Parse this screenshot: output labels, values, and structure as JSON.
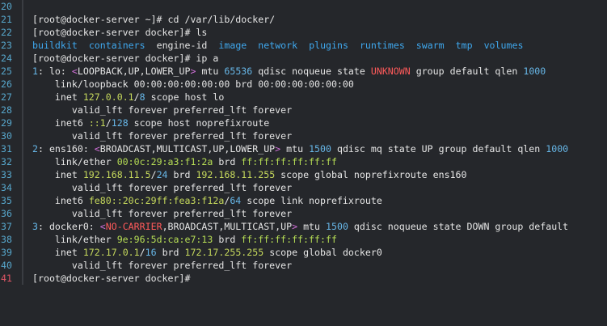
{
  "terminal": {
    "lines": [
      {
        "n": "20",
        "segs": [
          {
            "t": "",
            "c": "default"
          }
        ]
      },
      {
        "n": "21",
        "segs": [
          {
            "t": "[root@docker-server ~]# ",
            "c": "prompt"
          },
          {
            "t": "cd /var/lib/docker/",
            "c": "cmd"
          }
        ]
      },
      {
        "n": "22",
        "segs": [
          {
            "t": "[root@docker-server docker]# ",
            "c": "prompt"
          },
          {
            "t": "ls",
            "c": "cmd"
          }
        ]
      },
      {
        "n": "23",
        "segs": [
          {
            "t": "buildkit",
            "c": "ls-dir"
          },
          {
            "t": "  ",
            "c": "default"
          },
          {
            "t": "containers",
            "c": "ls-dir"
          },
          {
            "t": "  ",
            "c": "default"
          },
          {
            "t": "engine-id",
            "c": "ls-file"
          },
          {
            "t": "  ",
            "c": "default"
          },
          {
            "t": "image",
            "c": "ls-dir"
          },
          {
            "t": "  ",
            "c": "default"
          },
          {
            "t": "network",
            "c": "ls-dir"
          },
          {
            "t": "  ",
            "c": "default"
          },
          {
            "t": "plugins",
            "c": "ls-dir"
          },
          {
            "t": "  ",
            "c": "default"
          },
          {
            "t": "runtimes",
            "c": "ls-dir"
          },
          {
            "t": "  ",
            "c": "default"
          },
          {
            "t": "swarm",
            "c": "ls-dir"
          },
          {
            "t": "  ",
            "c": "default"
          },
          {
            "t": "tmp",
            "c": "ls-dir"
          },
          {
            "t": "  ",
            "c": "default"
          },
          {
            "t": "volumes",
            "c": "ls-dir"
          }
        ]
      },
      {
        "n": "24",
        "segs": [
          {
            "t": "[root@docker-server docker]# ",
            "c": "prompt"
          },
          {
            "t": "ip a",
            "c": "cmd"
          }
        ]
      },
      {
        "n": "25",
        "segs": [
          {
            "t": "1",
            "c": "num"
          },
          {
            "t": ": lo: ",
            "c": "default"
          },
          {
            "t": "<",
            "c": "sym"
          },
          {
            "t": "LOOPBACK,UP,LOWER_UP",
            "c": "default"
          },
          {
            "t": ">",
            "c": "sym"
          },
          {
            "t": " mtu ",
            "c": "default"
          },
          {
            "t": "65536",
            "c": "num"
          },
          {
            "t": " qdisc noqueue state ",
            "c": "default"
          },
          {
            "t": "UNKNOWN",
            "c": "bad"
          },
          {
            "t": " group default qlen ",
            "c": "default"
          },
          {
            "t": "1000",
            "c": "num"
          }
        ]
      },
      {
        "n": "26",
        "segs": [
          {
            "t": "    link/loopback 00:00:00:00:00:00 brd 00:00:00:00:00:00",
            "c": "default"
          }
        ]
      },
      {
        "n": "27",
        "segs": [
          {
            "t": "    inet ",
            "c": "default"
          },
          {
            "t": "127.0.0.1",
            "c": "addr"
          },
          {
            "t": "/",
            "c": "default"
          },
          {
            "t": "8",
            "c": "mask"
          },
          {
            "t": " scope host lo",
            "c": "default"
          }
        ]
      },
      {
        "n": "28",
        "segs": [
          {
            "t": "       valid_lft forever preferred_lft forever",
            "c": "default"
          }
        ]
      },
      {
        "n": "29",
        "segs": [
          {
            "t": "    inet6 ",
            "c": "default"
          },
          {
            "t": "::1",
            "c": "addr"
          },
          {
            "t": "/",
            "c": "default"
          },
          {
            "t": "128",
            "c": "mask"
          },
          {
            "t": " scope host noprefixroute",
            "c": "default"
          }
        ]
      },
      {
        "n": "30",
        "segs": [
          {
            "t": "       valid_lft forever preferred_lft forever",
            "c": "default"
          }
        ]
      },
      {
        "n": "31",
        "segs": [
          {
            "t": "2",
            "c": "num"
          },
          {
            "t": ": ens160: ",
            "c": "default"
          },
          {
            "t": "<",
            "c": "sym"
          },
          {
            "t": "BROADCAST,MULTICAST,UP,LOWER_UP",
            "c": "default"
          },
          {
            "t": ">",
            "c": "sym"
          },
          {
            "t": " mtu ",
            "c": "default"
          },
          {
            "t": "1500",
            "c": "num"
          },
          {
            "t": " qdisc mq state UP group default qlen ",
            "c": "default"
          },
          {
            "t": "1000",
            "c": "num"
          }
        ]
      },
      {
        "n": "32",
        "segs": [
          {
            "t": "    link/ether ",
            "c": "default"
          },
          {
            "t": "00:0c:29:a3:f1:2a",
            "c": "mac"
          },
          {
            "t": " brd ",
            "c": "default"
          },
          {
            "t": "ff:ff:ff:ff:ff:ff",
            "c": "mac"
          }
        ]
      },
      {
        "n": "33",
        "segs": [
          {
            "t": "    inet ",
            "c": "default"
          },
          {
            "t": "192.168.11.5",
            "c": "addr"
          },
          {
            "t": "/",
            "c": "default"
          },
          {
            "t": "24",
            "c": "mask"
          },
          {
            "t": " brd ",
            "c": "default"
          },
          {
            "t": "192.168.11.255",
            "c": "addr"
          },
          {
            "t": " scope global noprefixroute ens160",
            "c": "default"
          }
        ]
      },
      {
        "n": "34",
        "segs": [
          {
            "t": "       valid_lft forever preferred_lft forever",
            "c": "default"
          }
        ]
      },
      {
        "n": "35",
        "segs": [
          {
            "t": "    inet6 ",
            "c": "default"
          },
          {
            "t": "fe80::20c:29ff:fea3:f12a",
            "c": "addr"
          },
          {
            "t": "/",
            "c": "default"
          },
          {
            "t": "64",
            "c": "mask"
          },
          {
            "t": " scope link noprefixroute",
            "c": "default"
          }
        ]
      },
      {
        "n": "36",
        "segs": [
          {
            "t": "       valid_lft forever preferred_lft forever",
            "c": "default"
          }
        ]
      },
      {
        "n": "37",
        "segs": [
          {
            "t": "3",
            "c": "num"
          },
          {
            "t": ": docker0: ",
            "c": "default"
          },
          {
            "t": "<",
            "c": "sym"
          },
          {
            "t": "NO-CARRIER",
            "c": "bad"
          },
          {
            "t": ",BROADCAST,MULTICAST,UP",
            "c": "default"
          },
          {
            "t": ">",
            "c": "sym"
          },
          {
            "t": " mtu ",
            "c": "default"
          },
          {
            "t": "1500",
            "c": "num"
          },
          {
            "t": " qdisc noqueue state DOWN group default",
            "c": "default"
          }
        ]
      },
      {
        "n": "38",
        "segs": [
          {
            "t": "    link/ether ",
            "c": "default"
          },
          {
            "t": "9e:96:5d:ca:e7:13",
            "c": "mac"
          },
          {
            "t": " brd ",
            "c": "default"
          },
          {
            "t": "ff:ff:ff:ff:ff:ff",
            "c": "mac"
          }
        ]
      },
      {
        "n": "39",
        "segs": [
          {
            "t": "    inet ",
            "c": "default"
          },
          {
            "t": "172.17.0.1",
            "c": "addr"
          },
          {
            "t": "/",
            "c": "default"
          },
          {
            "t": "16",
            "c": "mask"
          },
          {
            "t": " brd ",
            "c": "default"
          },
          {
            "t": "172.17.255.255",
            "c": "addr"
          },
          {
            "t": " scope global docker0",
            "c": "default"
          }
        ]
      },
      {
        "n": "40",
        "segs": [
          {
            "t": "       valid_lft forever preferred_lft forever",
            "c": "default"
          }
        ]
      },
      {
        "n": "41",
        "current": true,
        "segs": [
          {
            "t": "[root@docker-server docker]# ",
            "c": "prompt"
          }
        ]
      }
    ]
  }
}
